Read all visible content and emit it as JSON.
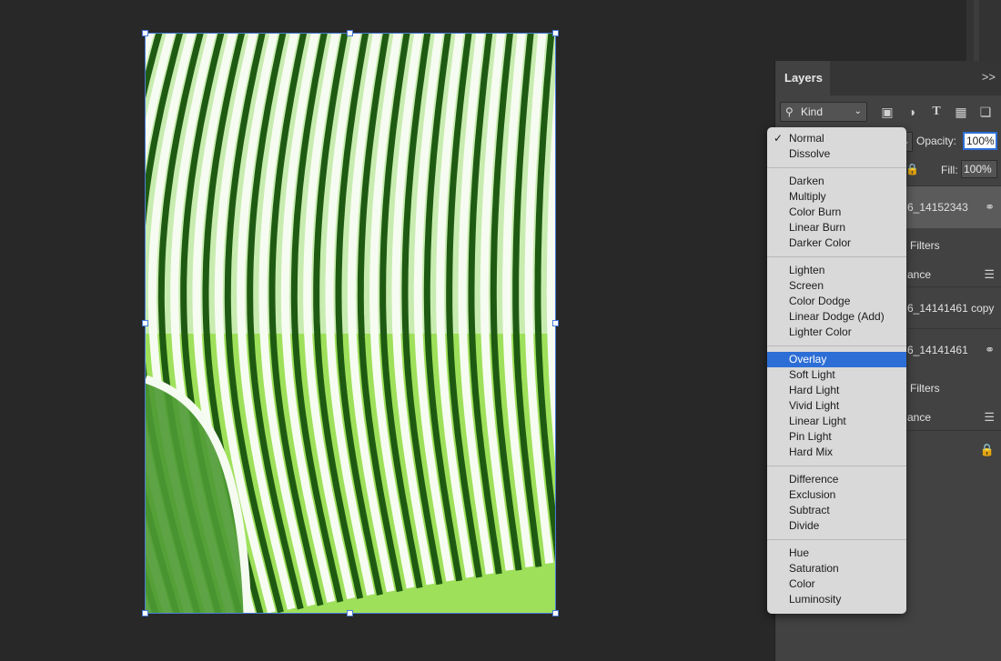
{
  "panel": {
    "title": "Layers",
    "menu_glyph": ">>",
    "filter_kind": "Kind",
    "opacity_label": "Opacity:",
    "opacity_value": "100%",
    "fill_label": "Fill:",
    "fill_value": "100%",
    "layers": [
      {
        "text": "6_14152343",
        "selected": true
      },
      {
        "text": "Filters"
      },
      {
        "text": "ance"
      },
      {
        "text": "6_14141461 copy"
      },
      {
        "text": "6_14141461"
      },
      {
        "text": "Filters"
      },
      {
        "text": "ance"
      }
    ]
  },
  "blend_menu": {
    "selected": "Overlay",
    "checked": "Normal",
    "groups": [
      [
        "Normal",
        "Dissolve"
      ],
      [
        "Darken",
        "Multiply",
        "Color Burn",
        "Linear Burn",
        "Darker Color"
      ],
      [
        "Lighten",
        "Screen",
        "Color Dodge",
        "Linear Dodge (Add)",
        "Lighter Color"
      ],
      [
        "Overlay",
        "Soft Light",
        "Hard Light",
        "Vivid Light",
        "Linear Light",
        "Pin Light",
        "Hard Mix"
      ],
      [
        "Difference",
        "Exclusion",
        "Subtract",
        "Divide"
      ],
      [
        "Hue",
        "Saturation",
        "Color",
        "Luminosity"
      ]
    ]
  },
  "colors": {
    "accent": "#2d6ed6",
    "canvas_bg": "#282828",
    "panel_bg": "#424242",
    "image_green": "#9ee05a",
    "image_dark_green": "#1f5a12"
  }
}
